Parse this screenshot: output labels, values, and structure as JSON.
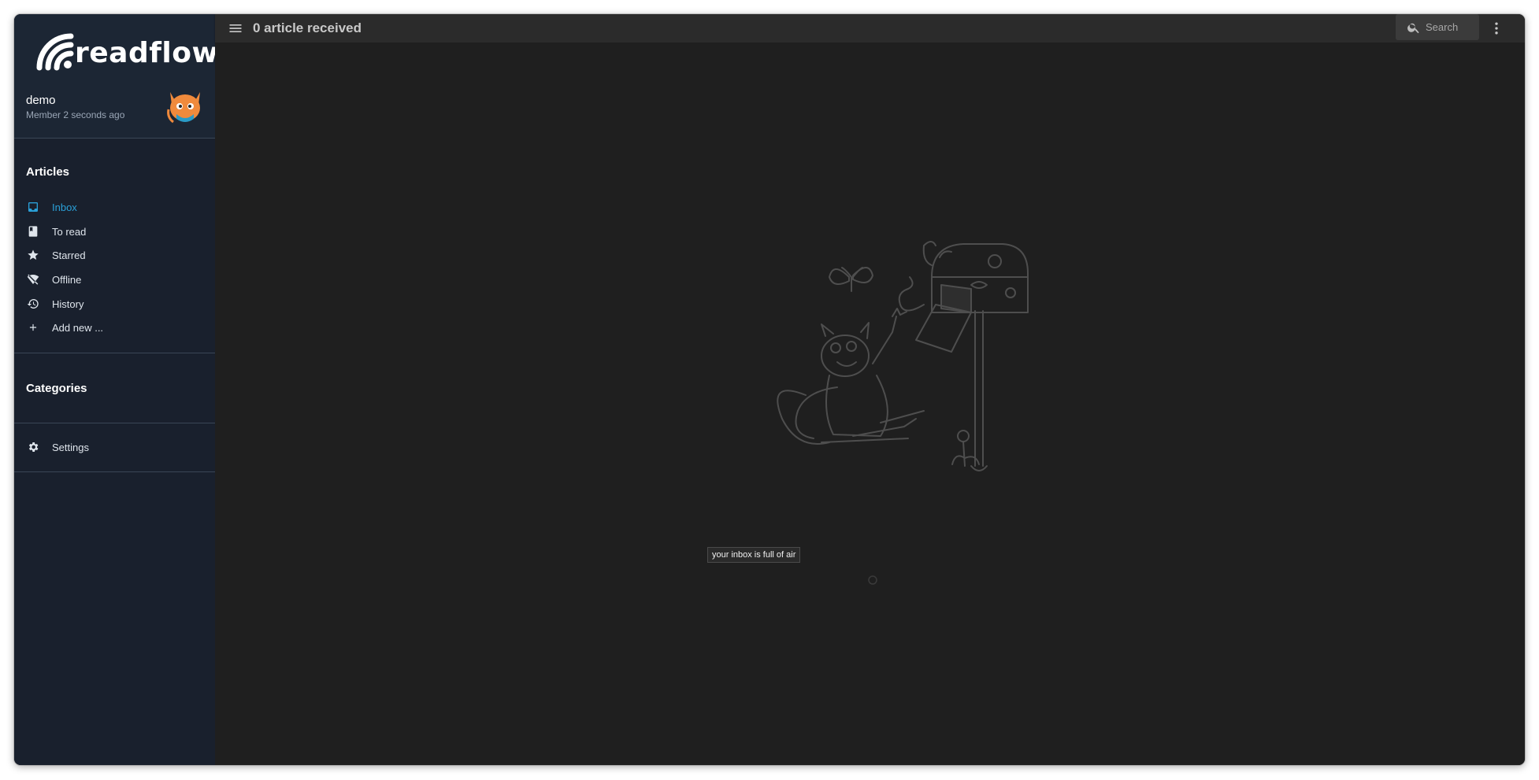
{
  "app": {
    "logo_text": "readflow",
    "accent_color": "#2aa0d8",
    "sidebar_bg": "#19202d"
  },
  "user": {
    "name": "demo",
    "since": "Member 2 seconds ago",
    "avatar_icon": "cat-avatar-icon"
  },
  "sidebar": {
    "articles_title": "Articles",
    "items": [
      {
        "label": "Inbox",
        "icon": "inbox-icon",
        "active": true
      },
      {
        "label": "To read",
        "icon": "bookmark-icon",
        "active": false
      },
      {
        "label": "Starred",
        "icon": "star-icon",
        "active": false
      },
      {
        "label": "Offline",
        "icon": "offline-icon",
        "active": false
      },
      {
        "label": "History",
        "icon": "history-icon",
        "active": false
      },
      {
        "label": "Add new ...",
        "icon": "plus-icon",
        "active": false
      }
    ],
    "categories_title": "Categories",
    "settings_label": "Settings"
  },
  "header": {
    "title": "0 article received",
    "search_placeholder": "Search"
  },
  "main": {
    "empty_message": "your inbox is full of air",
    "illustration_icon": "cat-mailbox-illustration"
  }
}
